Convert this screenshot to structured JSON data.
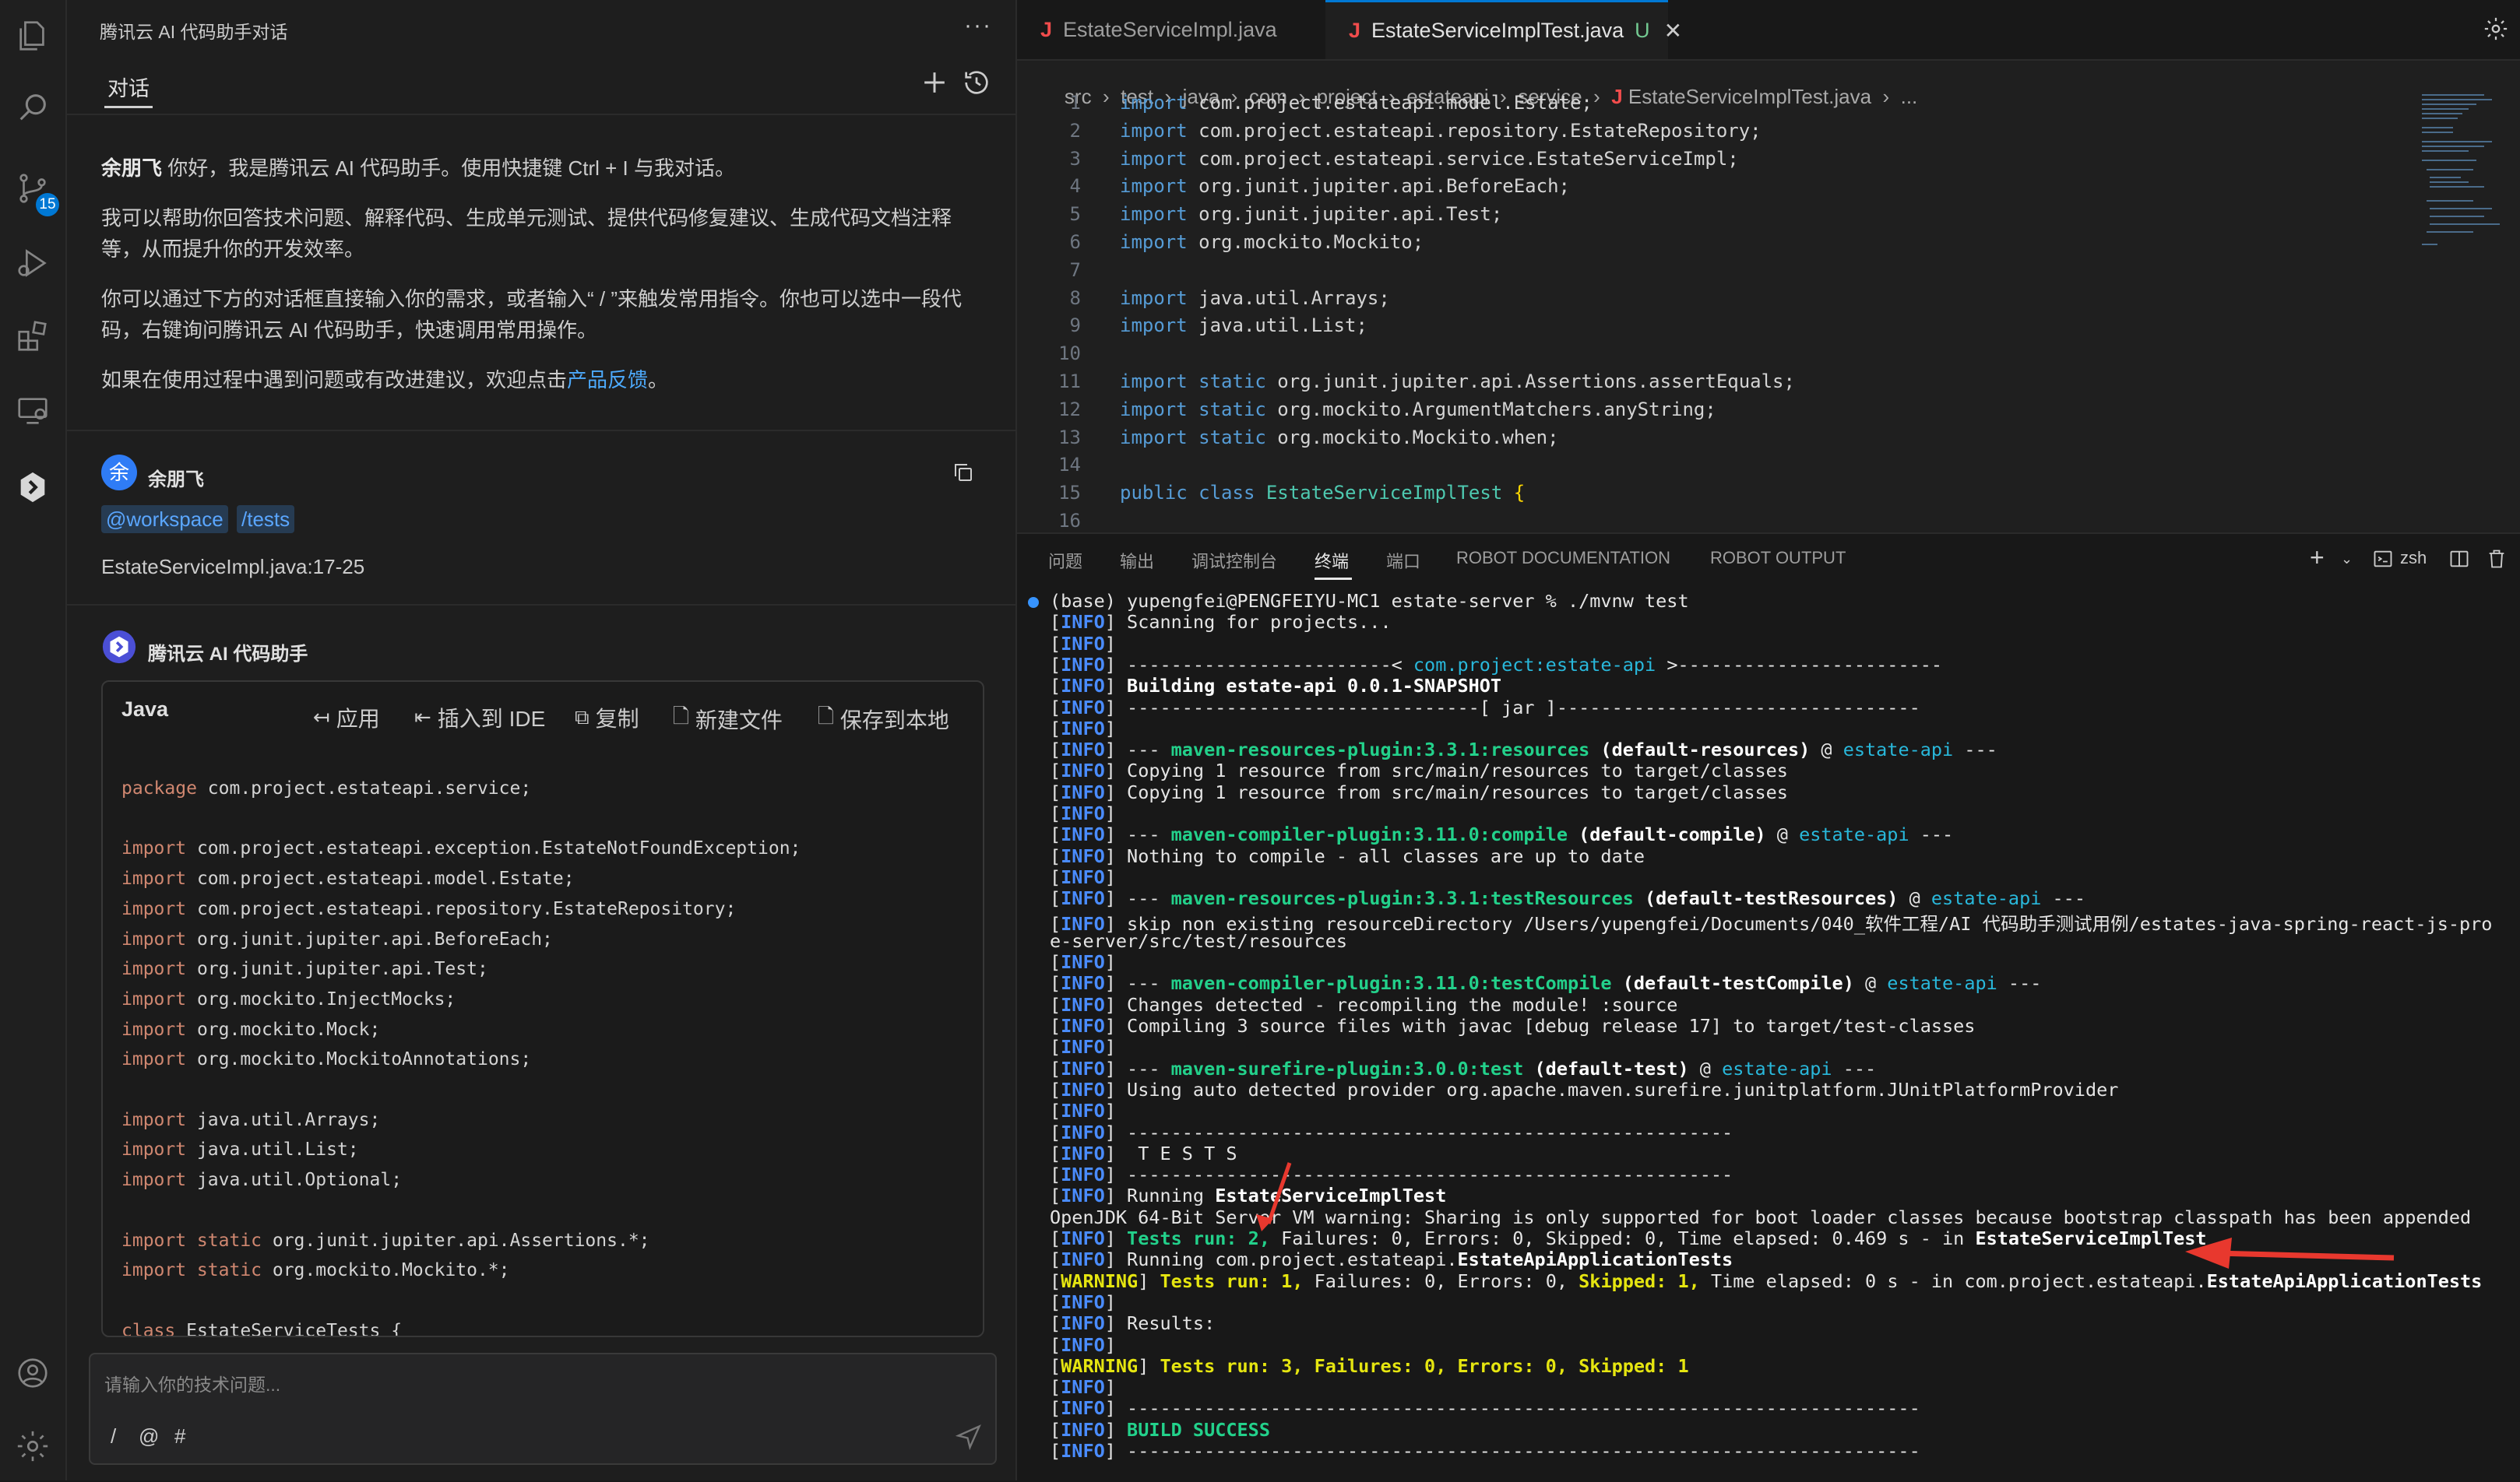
{
  "activity_bar": {
    "scm_badge": "15"
  },
  "chat": {
    "panel_title": "腾讯云 AI 代码助手对话",
    "more": "···",
    "tab_label": "对话",
    "welcome": {
      "p1_name": "余朋飞",
      "p1_text": " 你好，我是腾讯云 AI 代码助手。使用快捷键 Ctrl + I 与我对话。",
      "p2_line1": "我可以帮助你回答技术问题、解释代码、生成单元测试、提供代码修复建议、生成代码文档注释",
      "p2_line2": "等，从而提升你的开发效率。",
      "p3_line1": "你可以通过下方的对话框直接输入你的需求，或者输入“ / ”来触发常用指令。你也可以选中一段代",
      "p3_line2": "码，右键询问腾讯云 AI 代码助手，快速调用常用操作。",
      "p4_text": "如果在使用过程中遇到问题或有改进建议，欢迎点击",
      "p4_link": "产品反馈",
      "p4_end": "。"
    },
    "user": {
      "avatar_char": "余",
      "name": "余朋飞",
      "tag1": "@workspace",
      "tag2": "/tests",
      "message": "EstateServiceImpl.java:17-25"
    },
    "assistant": {
      "name": "腾讯云 AI 代码助手",
      "code_lang": "Java",
      "actions": {
        "apply": "应用",
        "insert": "插入到 IDE",
        "copy": "复制",
        "new_file": "新建文件",
        "save_local": "保存到本地"
      },
      "code": [
        {
          "kw": "package",
          "rest": " com.project.estateapi.service;"
        },
        {
          "kw": "",
          "rest": ""
        },
        {
          "kw": "import",
          "rest": " com.project.estateapi.exception.EstateNotFoundException;"
        },
        {
          "kw": "import",
          "rest": " com.project.estateapi.model.Estate;"
        },
        {
          "kw": "import",
          "rest": " com.project.estateapi.repository.EstateRepository;"
        },
        {
          "kw": "import",
          "rest": " org.junit.jupiter.api.BeforeEach;"
        },
        {
          "kw": "import",
          "rest": " org.junit.jupiter.api.Test;"
        },
        {
          "kw": "import",
          "rest": " org.mockito.InjectMocks;"
        },
        {
          "kw": "import",
          "rest": " org.mockito.Mock;"
        },
        {
          "kw": "import",
          "rest": " org.mockito.MockitoAnnotations;"
        },
        {
          "kw": "",
          "rest": ""
        },
        {
          "kw": "import",
          "rest": " java.util.Arrays;"
        },
        {
          "kw": "import",
          "rest": " java.util.List;"
        },
        {
          "kw": "import",
          "rest": " java.util.Optional;"
        },
        {
          "kw": "",
          "rest": ""
        },
        {
          "kw": "import static",
          "rest": " org.junit.jupiter.api.Assertions.*;"
        },
        {
          "kw": "import static",
          "rest": " org.mockito.Mockito.*;"
        },
        {
          "kw": "",
          "rest": ""
        },
        {
          "kw": "class",
          "rest": " EstateServiceTests {"
        }
      ]
    },
    "input": {
      "placeholder": "请输入你的技术问题...",
      "slash": "/",
      "at": "@",
      "hash": "#"
    }
  },
  "editor": {
    "tabs": [
      {
        "label": "EstateServiceImpl.java",
        "suffix": ""
      },
      {
        "label": "EstateServiceImplTest.java",
        "suffix": "U"
      }
    ],
    "breadcrumb": [
      "src",
      "test",
      "java",
      "com",
      "project",
      "estateapi",
      "service",
      "EstateServiceImplTest.java",
      "..."
    ],
    "lines": [
      {
        "n": "1",
        "kw": "import",
        "rest": " com.project.estateapi.model.Estate;"
      },
      {
        "n": "2",
        "kw": "import",
        "rest": " com.project.estateapi.repository.EstateRepository;"
      },
      {
        "n": "3",
        "kw": "import",
        "rest": " com.project.estateapi.service.EstateServiceImpl;"
      },
      {
        "n": "4",
        "kw": "import",
        "rest": " org.junit.jupiter.api.BeforeEach;"
      },
      {
        "n": "5",
        "kw": "import",
        "rest": " org.junit.jupiter.api.Test;"
      },
      {
        "n": "6",
        "kw": "import",
        "rest": " org.mockito.Mockito;"
      },
      {
        "n": "7",
        "kw": "",
        "rest": ""
      },
      {
        "n": "8",
        "kw": "import",
        "rest": " java.util.Arrays;"
      },
      {
        "n": "9",
        "kw": "import",
        "rest": " java.util.List;"
      },
      {
        "n": "10",
        "kw": "",
        "rest": ""
      },
      {
        "n": "11",
        "kw": "import static",
        "rest": " org.junit.jupiter.api.Assertions.assertEquals;"
      },
      {
        "n": "12",
        "kw": "import static",
        "rest": " org.mockito.ArgumentMatchers.anyString;"
      },
      {
        "n": "13",
        "kw": "import static",
        "rest": " org.mockito.Mockito.when;"
      },
      {
        "n": "14",
        "kw": "",
        "rest": ""
      },
      {
        "n": "15",
        "kw": "public class",
        "rest": " EstateServiceImplTest {"
      },
      {
        "n": "16",
        "kw": "",
        "rest": ""
      }
    ]
  },
  "panel": {
    "tabs": [
      "问题",
      "输出",
      "调试控制台",
      "终端",
      "端口",
      "ROBOT DOCUMENTATION",
      "ROBOT OUTPUT"
    ],
    "shell": "zsh",
    "terminal": {
      "prompt": "(base) yupengfei@PENGFEIYU-MC1 estate-server % ./mvnw test",
      "l_scan": "Scanning for projects...",
      "l_proj_l": "------------------------< ",
      "l_proj_name": "com.project:estate-api",
      "l_proj_r": " >------------------------",
      "l_build": "Building estate-api 0.0.1-SNAPSHOT",
      "l_jar": "--------------------------------[ jar ]---------------------------------",
      "l_res_plugin": "maven-resources-plugin:3.3.1:resources",
      "l_res_goal": " (default-resources)",
      "l_artifact": "estate-api",
      "l_copy1": "Copying 1 resource from src/main/resources to target/classes",
      "l_copy2": "Copying 1 resource from src/main/resources to target/classes",
      "l_comp_plugin": "maven-compiler-plugin:3.11.0:compile",
      "l_comp_goal": " (default-compile)",
      "l_nothing": "Nothing to compile - all classes are up to date",
      "l_tres_plugin": "maven-resources-plugin:3.3.1:testResources",
      "l_tres_goal": " (default-testResources)",
      "l_skip1": "skip non existing resourceDirectory /Users/yupengfei/Documents/040_软件工程/AI 代码助手测试用例/estates-java-spring-react-js-pro",
      "l_skip2": "e-server/src/test/resources",
      "l_tcomp_plugin": "maven-compiler-plugin:3.11.0:testCompile",
      "l_tcomp_goal": " (default-testCompile)",
      "l_changes": "Changes detected - recompiling the module! :source",
      "l_compiling": "Compiling 3 source files with javac [debug release 17] to target/test-classes",
      "l_sure_plugin": "maven-surefire-plugin:3.0.0:test",
      "l_sure_goal": " (default-test)",
      "l_provider": "Using auto detected provider org.apache.maven.surefire.junitplatform.JUnitPlatformProvider",
      "l_dashes": "-------------------------------------------------------",
      "l_tests": " T E S T S",
      "l_running": "Running ",
      "l_running_cls": "EstateServiceImplTest",
      "l_openjdk": "OpenJDK 64-Bit Server VM warning: Sharing is only supported for boot loader classes because bootstrap classpath has been appended",
      "l_r1_a": "Tests run: 2,",
      "l_r1_b": " Failures: 0, Errors: 0, Skipped: 0, Time elapsed: 0.469 s - in ",
      "l_r1_cls": "EstateServiceImplTest",
      "l_running2": "Running com.project.estateapi.",
      "l_running2_cls": "EstateApiApplicationTests",
      "l_w1_a": "Tests run: 1,",
      "l_w1_b": " Failures: 0, Errors: 0, ",
      "l_w1_c": "Skipped: 1,",
      "l_w1_d": " Time elapsed: 0 s - in com.project.estateapi.",
      "l_w1_cls": "EstateApiApplicationTests",
      "l_results": "Results:",
      "l_w2": "Tests run: 3, Failures: 0, Errors: 0, Skipped: 1",
      "l_dashes2": "------------------------------------------------------------------------",
      "l_success": "BUILD SUCCESS",
      "info": "INFO",
      "warning": "WARNING",
      "dash3": "---"
    }
  },
  "colors": {
    "accent": "#0078d4",
    "terminal_info": "#4a8cff",
    "terminal_warning": "#e5e510",
    "terminal_success": "#23d18b",
    "annotation_arrow": "#e8382e"
  }
}
